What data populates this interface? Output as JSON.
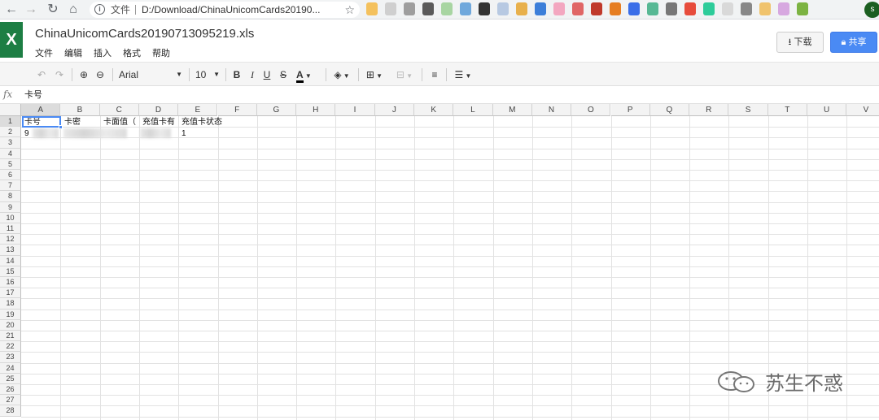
{
  "browser": {
    "back_icon": "arrow-left-icon",
    "forward_icon": "arrow-right-icon",
    "reload_icon": "reload-icon",
    "home_icon": "home-icon",
    "url_label": "文件",
    "url": "D:/Download/ChinaUnicomCards20190...",
    "profile_initial": "s"
  },
  "app": {
    "logo": "X",
    "filename": "ChinaUnicomCards20190713095219.xls",
    "menu": [
      "文件",
      "编辑",
      "插入",
      "格式",
      "帮助"
    ],
    "download_label": "下载",
    "share_label": "共享"
  },
  "toolbar": {
    "font_name": "Arial",
    "font_size": "10",
    "bold": "B",
    "italic": "I",
    "underline": "U",
    "strike": "S",
    "text_color": "A"
  },
  "formula_bar": {
    "fx": "fx",
    "value": "卡号"
  },
  "sheet": {
    "columns": [
      "A",
      "B",
      "C",
      "D",
      "E",
      "F",
      "G",
      "H",
      "I",
      "J",
      "K",
      "L",
      "M",
      "N",
      "O",
      "P",
      "Q",
      "R",
      "S",
      "T",
      "U",
      "V"
    ],
    "rows": [
      "1",
      "2",
      "3",
      "4",
      "5",
      "6",
      "7",
      "8",
      "9",
      "10",
      "11",
      "12",
      "13",
      "14",
      "15",
      "16",
      "17",
      "18",
      "19",
      "20",
      "21",
      "22",
      "23",
      "24",
      "25",
      "26",
      "27",
      "28"
    ],
    "row1": [
      "卡号",
      "卡密",
      "卡面值（",
      "充值卡有",
      "充值卡状态"
    ],
    "row2": [
      "9",
      "",
      "",
      "",
      "1"
    ]
  },
  "watermark": "苏生不惑"
}
